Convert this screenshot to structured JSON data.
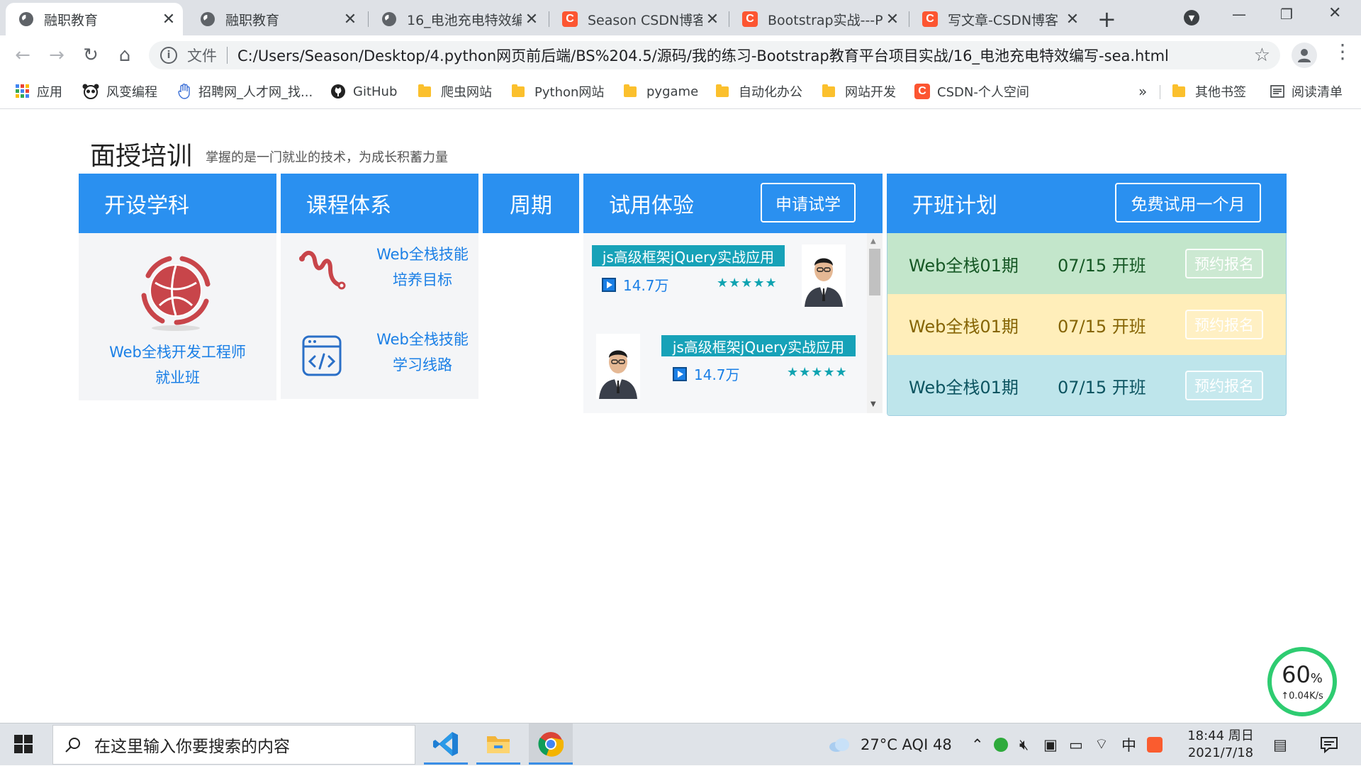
{
  "browser": {
    "tabs": [
      {
        "title": "融职教育",
        "icon": "globe-icon",
        "active": true
      },
      {
        "title": "融职教育",
        "icon": "globe-icon",
        "active": false
      },
      {
        "title": "16_电池充电特效编",
        "icon": "globe-icon",
        "active": false
      },
      {
        "title": "Season CSDN博客",
        "icon": "csdn-icon",
        "active": false
      },
      {
        "title": "Bootstrap实战---P",
        "icon": "csdn-icon",
        "active": false
      },
      {
        "title": "写文章-CSDN博客",
        "icon": "csdn-icon",
        "active": false
      }
    ],
    "new_tab": "+",
    "window_controls": {
      "minimize": "—",
      "maximize": "❐",
      "close": "✕"
    },
    "address": {
      "scheme_label": "文件",
      "url": "C:/Users/Season/Desktop/4.python网页前后端/BS%204.5/源码/我的练习-Bootstrap教育平台项目实战/16_电池充电特效编写-sea.html"
    },
    "bookmarks": [
      {
        "label": "应用",
        "icon": "apps-grid-icon"
      },
      {
        "label": "风变编程",
        "icon": "panda-icon"
      },
      {
        "label": "招聘网_人才网_找...",
        "icon": "hand-icon"
      },
      {
        "label": "GitHub",
        "icon": "github-icon"
      },
      {
        "label": "爬虫网站",
        "icon": "folder-icon"
      },
      {
        "label": "Python网站",
        "icon": "folder-icon"
      },
      {
        "label": "pygame",
        "icon": "folder-icon"
      },
      {
        "label": "自动化办公",
        "icon": "folder-icon"
      },
      {
        "label": "网站开发",
        "icon": "folder-icon"
      },
      {
        "label": "CSDN-个人空间",
        "icon": "csdn-icon"
      }
    ],
    "more_bookmarks": "»",
    "other_bookmarks": "其他书签",
    "reading_list": "阅读清单"
  },
  "page": {
    "title": "面授培训",
    "subtitle": "掌握的是一门就业的技术，为成长积蓄力量",
    "columns": {
      "subjects": {
        "header": "开设学科",
        "course_line1": "Web全栈开发工程师",
        "course_line2": "就业班"
      },
      "curriculum": {
        "header": "课程体系",
        "items": [
          {
            "line1": "Web全栈技能",
            "line2": "培养目标",
            "icon": "route-icon"
          },
          {
            "line1": "Web全栈技能",
            "line2": "学习线路",
            "icon": "code-window-icon"
          }
        ]
      },
      "period": {
        "header": "周期"
      },
      "trial": {
        "header": "试用体验",
        "button": "申请试学",
        "courses": [
          {
            "title": "js高级框架jQuery实战应用",
            "plays": "14.7万",
            "rating": "★★★★★"
          },
          {
            "title": "js高级框架jQuery实战应用",
            "plays": "14.7万",
            "rating": "★★★★★"
          }
        ]
      },
      "plan": {
        "header": "开班计划",
        "button": "免费试用一个月",
        "rows": [
          {
            "name": "Web全栈01期",
            "date": "07/15 开班",
            "action": "预约报名",
            "bg": "#c3e6cb"
          },
          {
            "name": "Web全栈01期",
            "date": "07/15 开班",
            "action": "预约报名",
            "bg": "#ffeeba"
          },
          {
            "name": "Web全栈01期",
            "date": "07/15 开班",
            "action": "预约报名",
            "bg": "#bee5eb"
          }
        ]
      }
    },
    "colors": {
      "header_blue": "#2a90f0",
      "link_blue": "#1a7fe6",
      "tag_teal": "#17a2b8"
    }
  },
  "speed_widget": {
    "percent": "60",
    "percent_unit": "%",
    "rate": "↑0.04K/s"
  },
  "taskbar": {
    "search_placeholder": "在这里输入你要搜索的内容",
    "weather": "27°C  AQI 48",
    "ime": "中",
    "time": "18:44 周日",
    "date": "2021/7/18"
  }
}
